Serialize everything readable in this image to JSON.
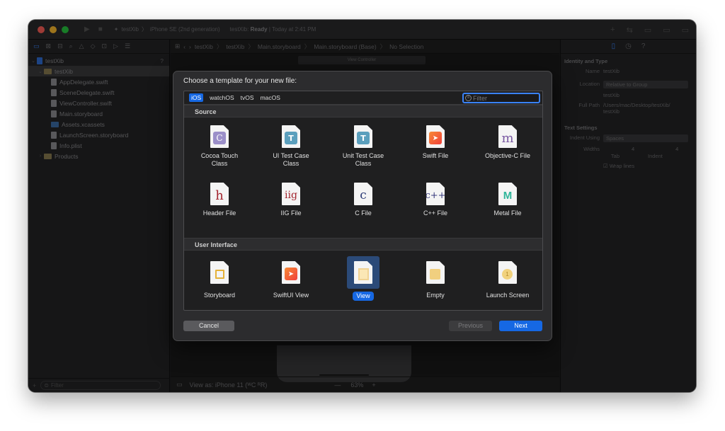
{
  "titlebar": {
    "scheme": "testXib",
    "device": "iPhone SE (2nd generation)",
    "project": "testXib:",
    "status": "Ready",
    "time": "Today at 2:41 PM"
  },
  "navigator": {
    "items": [
      {
        "label": "testXib",
        "badge": "?"
      },
      {
        "label": "testXib"
      },
      {
        "label": "AppDelegate.swift"
      },
      {
        "label": "SceneDelegate.swift"
      },
      {
        "label": "ViewController.swift"
      },
      {
        "label": "Main.storyboard"
      },
      {
        "label": "Assets.xcassets"
      },
      {
        "label": "LaunchScreen.storyboard"
      },
      {
        "label": "Info.plist"
      },
      {
        "label": "Products"
      }
    ],
    "filter_placeholder": "Filter"
  },
  "editor": {
    "breadcrumb": [
      "testXib",
      "testXib",
      "Main.storyboard",
      "Main.storyboard (Base)",
      "No Selection"
    ],
    "vc_title": "View Controller",
    "view_as": "View as: iPhone 11 (ᵂC ᴿR)",
    "zoom": "63%"
  },
  "inspector": {
    "identity_header": "Identity and Type",
    "name_label": "Name",
    "name_value": "testXib",
    "location_label": "Location",
    "location_value": "Relative to Group",
    "location_path": "testXib",
    "fullpath_label": "Full Path",
    "fullpath_value": "/Users/mac/Desktop/testXib/",
    "fullpath_value2": "testXib",
    "text_settings_header": "Text Settings",
    "indent_label": "Indent Using",
    "indent_value": "Spaces",
    "widths_label": "Widths",
    "tab_value": "4",
    "indent_width_value": "4",
    "tab_label": "Tab",
    "indent_sub_label": "Indent",
    "wrap_label": "Wrap lines"
  },
  "sheet": {
    "title": "Choose a template for your new file:",
    "platforms": [
      "iOS",
      "watchOS",
      "tvOS",
      "macOS"
    ],
    "filter_placeholder": "Filter",
    "source_header": "Source",
    "ui_header": "User Interface",
    "source_templates": [
      {
        "line1": "Cocoa Touch",
        "line2": "Class",
        "glyph": "C"
      },
      {
        "line1": "UI Test Case",
        "line2": "Class",
        "glyph": "T"
      },
      {
        "line1": "Unit Test Case",
        "line2": "Class",
        "glyph": "T"
      },
      {
        "line1": "Swift File",
        "line2": "",
        "glyph": "➤"
      },
      {
        "line1": "Objective-C File",
        "line2": "",
        "glyph": "m"
      },
      {
        "line1": "Header File",
        "line2": "",
        "glyph": "h"
      },
      {
        "line1": "IIG File",
        "line2": "",
        "glyph": "iig"
      },
      {
        "line1": "C File",
        "line2": "",
        "glyph": "c"
      },
      {
        "line1": "C++ File",
        "line2": "",
        "glyph": "c++"
      },
      {
        "line1": "Metal File",
        "line2": "",
        "glyph": "M"
      }
    ],
    "ui_templates": [
      {
        "line1": "Storyboard"
      },
      {
        "line1": "SwiftUI View",
        "glyph": "➤"
      },
      {
        "line1": "View"
      },
      {
        "line1": "Empty"
      },
      {
        "line1": "Launch Screen",
        "glyph": "1"
      }
    ],
    "cancel": "Cancel",
    "previous": "Previous",
    "next": "Next"
  },
  "colors": {
    "accent": "#1668e3",
    "window_bg": "#1e1e1f",
    "sheet_bg": "#2c2c2e"
  }
}
